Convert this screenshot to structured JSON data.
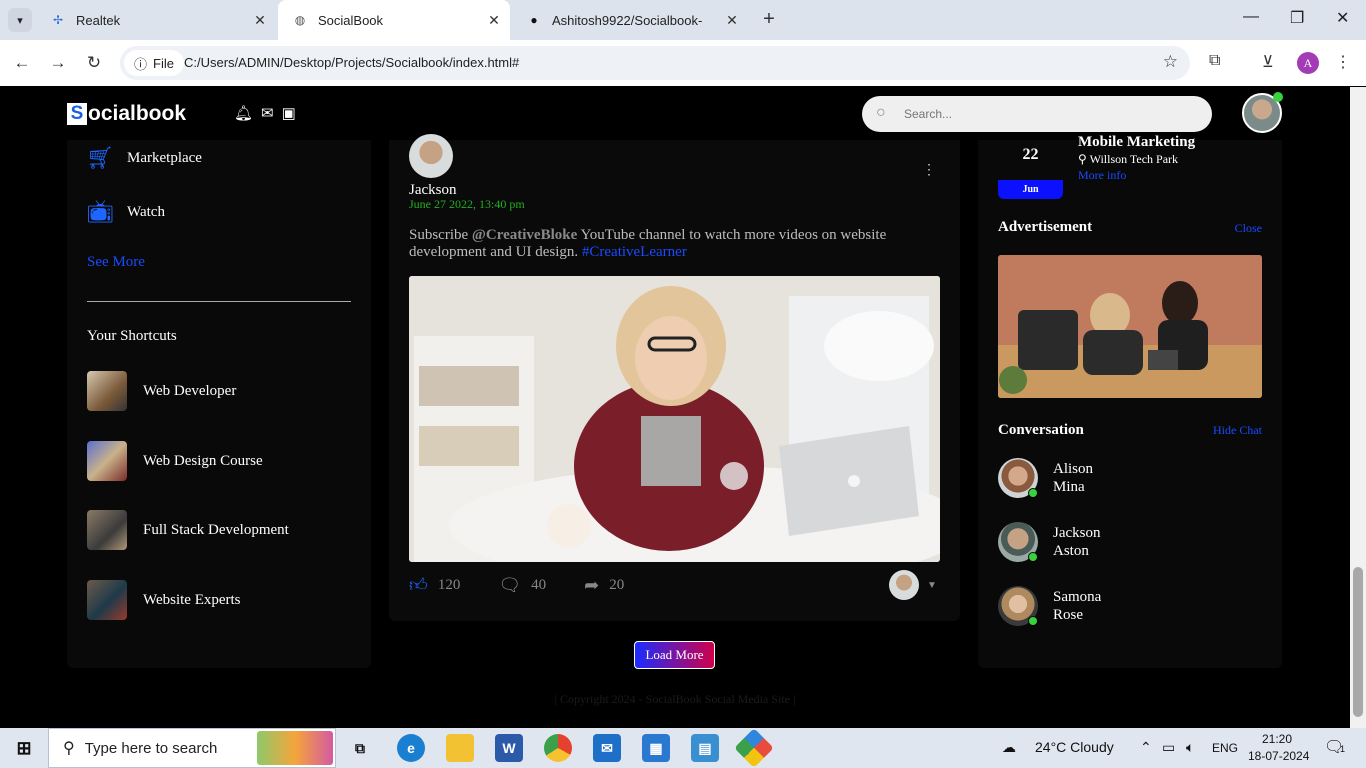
{
  "browser": {
    "tabs": [
      {
        "label": "Realtek",
        "icon": "realtek-icon"
      },
      {
        "label": "SocialBook",
        "icon": "globe-icon"
      },
      {
        "label": "Ashitosh9922/Socialbook-",
        "icon": "github-icon"
      }
    ],
    "address": {
      "chip": "File",
      "url": "C:/Users/ADMIN/Desktop/Projects/Socialbook/index.html#"
    },
    "profile_initial": "A"
  },
  "navbar": {
    "logo_letter": "S",
    "logo_rest": "ocialbook",
    "search_placeholder": "Search..."
  },
  "left_sidebar": {
    "links": [
      {
        "label": "Marketplace",
        "icon": "cart-icon"
      },
      {
        "label": "Watch",
        "icon": "tv-icon"
      }
    ],
    "see_more": "See More",
    "shortcuts_title": "Your Shortcuts",
    "shortcuts": [
      {
        "label": "Web Developer"
      },
      {
        "label": "Web Design Course"
      },
      {
        "label": "Full Stack Development"
      },
      {
        "label": "Website Experts"
      }
    ]
  },
  "post": {
    "author": "Jackson",
    "date": "June 27 2022, 13:40 pm",
    "text_prefix": "Subscribe ",
    "mention": "@CreativeBloke",
    "text_middle": " YouTube channel to watch more videos on website development and UI design. ",
    "hashtag": "#CreativeLearner",
    "likes": "120",
    "comments": "40",
    "shares": "20"
  },
  "load_more": "Load More",
  "footer": "| Copyright 2024 - SocialBook Social Media Site |",
  "right_sidebar": {
    "event": {
      "day": "22",
      "month": "Jun",
      "title": "Mobile Marketing",
      "location": "Willson Tech Park",
      "more": "More info"
    },
    "ad_title": "Advertisement",
    "ad_close": "Close",
    "conv_title": "Conversation",
    "conv_hide": "Hide Chat",
    "contacts": [
      {
        "first": "Alison",
        "last": "Mina"
      },
      {
        "first": "Jackson",
        "last": "Aston"
      },
      {
        "first": "Samona",
        "last": "Rose"
      }
    ]
  },
  "taskbar": {
    "search_placeholder": "Type here to search",
    "weather": "24°C  Cloudy",
    "lang": "ENG",
    "time": "21:20",
    "date": "18-07-2024",
    "notifications": "1"
  }
}
